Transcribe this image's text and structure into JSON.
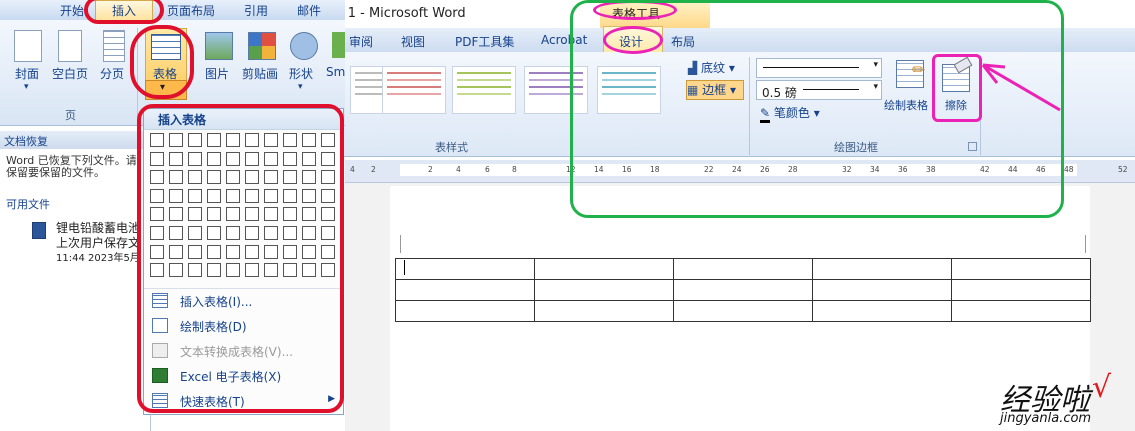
{
  "right_window": {
    "doc_title": "i 1 - Microsoft Word",
    "context_title": "表格工具",
    "tabs": [
      "审阅",
      "视图",
      "PDF工具集",
      "Acrobat",
      "设计",
      "布局"
    ],
    "group_table_styles": "表样式",
    "shading": "底纹",
    "borders": "边框",
    "line_weight": "0.5 磅",
    "pen_color": "笔颜色",
    "draw_table": "绘制表格",
    "eraser": "擦除",
    "group_draw_borders": "绘图边框",
    "ruler_ticks": [
      "4",
      "2",
      "2",
      "4",
      "6",
      "8",
      "12",
      "14",
      "16",
      "18",
      "22",
      "24",
      "26",
      "28",
      "32",
      "34",
      "36",
      "38",
      "42",
      "44",
      "46",
      "48",
      "52"
    ]
  },
  "left_window": {
    "tabs": [
      "开始",
      "插入",
      "页面布局",
      "引用",
      "邮件"
    ],
    "ribbon_buttons": [
      "封面",
      "空白页",
      "分页",
      "表格",
      "图片",
      "剪贴画",
      "形状",
      "Sm"
    ],
    "group_page": "页"
  },
  "recovery": {
    "title": "文档恢复",
    "msg": "Word 已恢复下列文件。请保留要保留的文件。",
    "available": "可用文件",
    "file_name": "锂电铅酸蓄电池",
    "file_sub": "上次用户保存文",
    "file_time": "11:44 2023年5月"
  },
  "dropdown": {
    "header": "插入表格",
    "items": [
      {
        "label": "插入表格(I)...",
        "enabled": true
      },
      {
        "label": "绘制表格(D)",
        "enabled": true
      },
      {
        "label": "文本转换成表格(V)...",
        "enabled": false
      },
      {
        "label": "Excel 电子表格(X)",
        "enabled": true
      },
      {
        "label": "快速表格(T)",
        "enabled": true
      }
    ]
  },
  "document_table": {
    "rows": 3,
    "cols": 5
  },
  "watermark": {
    "text": "经验啦",
    "check": "√",
    "url": "jingyanla.com"
  },
  "colors": {
    "annotation_red": "#e0102d",
    "annotation_pink": "#ec22b6",
    "annotation_green": "#1fb24a",
    "ribbon_blue": "#15428b"
  }
}
